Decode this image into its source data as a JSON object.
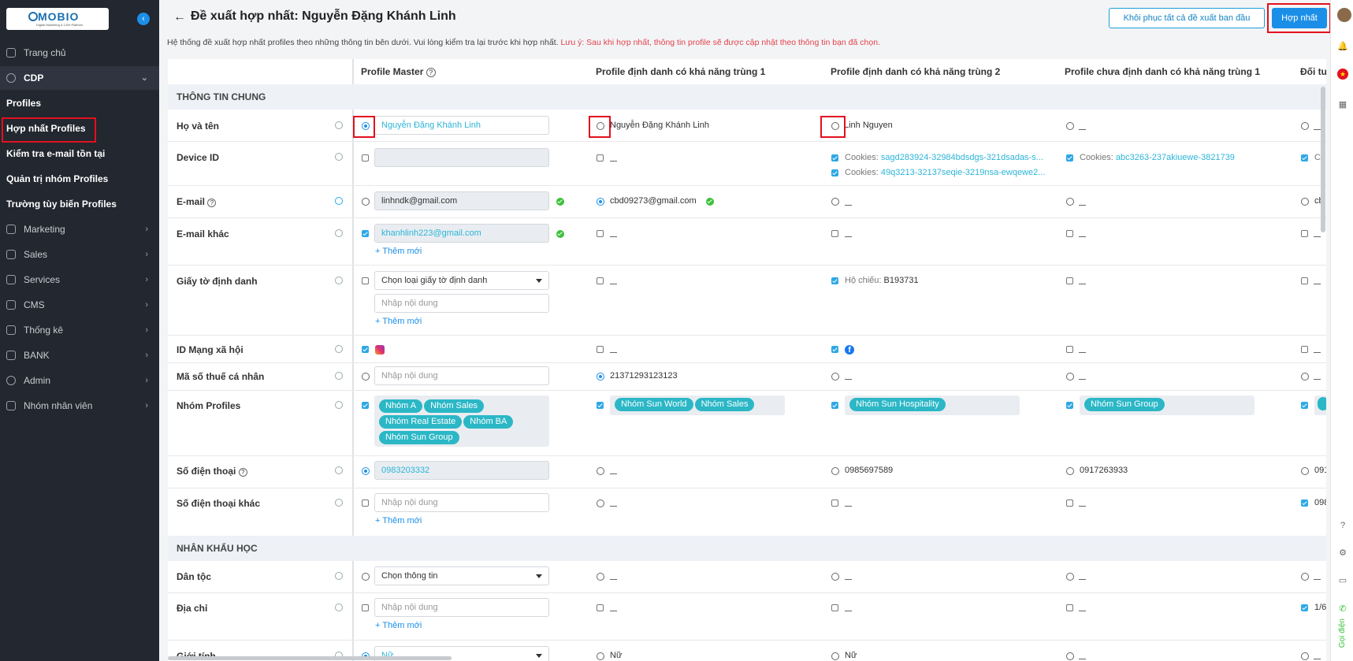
{
  "app": {
    "logo_text": "MOBIO",
    "logo_sub": "Digital Marketing & CDH Platform"
  },
  "sidebar": {
    "items": [
      {
        "label": "Trang chủ"
      },
      {
        "label": "CDP"
      },
      {
        "label": "Profiles"
      },
      {
        "label": "Hợp nhất Profiles"
      },
      {
        "label": "Kiểm tra e-mail tồn tại"
      },
      {
        "label": "Quản trị nhóm Profiles"
      },
      {
        "label": "Trường tùy biến Profiles"
      },
      {
        "label": "Marketing"
      },
      {
        "label": "Sales"
      },
      {
        "label": "Services"
      },
      {
        "label": "CMS"
      },
      {
        "label": "Thống kê"
      },
      {
        "label": "BANK"
      },
      {
        "label": "Admin"
      },
      {
        "label": "Nhóm nhân viên"
      }
    ]
  },
  "header": {
    "back_icon": "←",
    "title": "Đề xuất hợp nhất: Nguyễn Đặng Khánh Linh",
    "restore_label": "Khôi phục tất cả đề xuất ban đầu",
    "merge_label": "Hợp nhất",
    "description": "Hệ thống đề xuất hợp nhất profiles theo những thông tin bên dưới. Vui lòng kiểm tra lại trước khi hợp nhất.",
    "warning": "Lưu ý: Sau khi hợp nhất, thông tin profile sẽ được cập nhật theo thông tin bạn đã chọn."
  },
  "table": {
    "columns": [
      "Profile Master",
      "Profile định danh có khả năng trùng 1",
      "Profile định danh có khả năng trùng 2",
      "Profile chưa định danh có khả năng trùng 1",
      "Đối tư"
    ],
    "sections": [
      "THÔNG TIN CHUNG",
      "NHÂN KHẨU HỌC"
    ],
    "labels": {
      "name": "Họ và tên",
      "device": "Device ID",
      "email": "E-mail",
      "email_other": "E-mail khác",
      "id_doc": "Giấy tờ định danh",
      "social": "ID Mạng xã hội",
      "tax": "Mã số thuế cá nhân",
      "groups": "Nhóm Profiles",
      "phone": "Số điện thoại",
      "phone_other": "Số điện thoại khác",
      "ethnic": "Dân tộc",
      "address": "Địa chỉ",
      "gender": "Giới tính"
    },
    "values": {
      "name_master": "Nguyễn Đặng Khánh Linh",
      "name_p1": "Nguyễn Đặng Khánh Linh",
      "name_p2": "Linh Nguyen",
      "cookie_label": "Cookies:",
      "cookie_p2a": "sagd283924-32984bdsdgs-321dsadas-s...",
      "cookie_p2b": "49q3213-32137seqie-3219nsa-ewqewe2...",
      "cookie_u1": "abc3263-237akiuewe-3821739",
      "cookie_x": "Co",
      "email_master": "linhndk@gmail.com",
      "email_p1": "cbd09273@gmail.com",
      "email_x": "cb",
      "email_other_master": "khanhlinh223@gmail.com",
      "add_new": "+  Thêm mới",
      "id_select": "Chọn loại giấy tờ định danh",
      "input_placeholder": "Nhập nội dung",
      "passport_label": "Hộ chiếu:",
      "passport_value": "B193731",
      "tax_p1": "21371293123123",
      "groups_master": [
        "Nhóm A",
        "Nhóm Sales",
        "Nhóm Real Estate",
        "Nhóm BA",
        "Nhóm Sun Group"
      ],
      "groups_p1": [
        "Nhóm Sun World",
        "Nhóm Sales"
      ],
      "groups_p2": [
        "Nhóm Sun Hospitality"
      ],
      "groups_u1": [
        "Nhóm Sun Group"
      ],
      "phone_master": "0983203332",
      "phone_p2": "0985697589",
      "phone_u1": "0917263933",
      "phone_x": "091",
      "phone_other_x": "098",
      "ethnic_select": "Chọn thông tin",
      "address_x": "1/6",
      "gender_master": "Nữ",
      "gender_p1": "Nữ",
      "gender_p2": "Nữ"
    }
  },
  "rightbar": {
    "call_label": "Gọi điện"
  },
  "colors": {
    "accent": "#1b8fe8",
    "link": "#2cb5d8",
    "tag": "#2bb7c6",
    "sidebar": "#23272f",
    "highlight": "#e3101e"
  }
}
